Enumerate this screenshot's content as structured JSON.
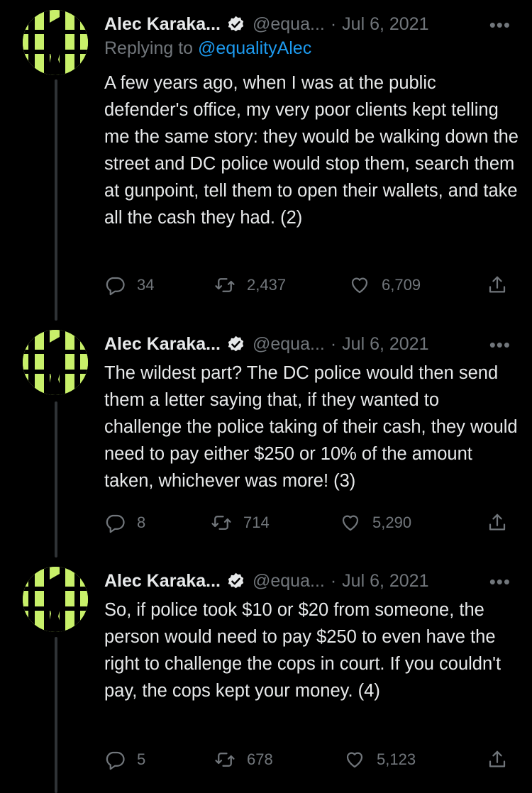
{
  "tweets": [
    {
      "author_name": "Alec Karaka...",
      "handle": "@equa...",
      "separator": "·",
      "date": "Jul 6, 2021",
      "more": "•••",
      "reply_prefix": "Replying to",
      "reply_handle": "@equalityAlec",
      "text": "A few years ago, when I was at the public defender's office, my very poor clients kept telling me the same story: they would be walking down the street and DC police would stop them, search them at gunpoint, tell them to open their wallets, and take all the cash they had. (2)",
      "replies": "34",
      "retweets": "2,437",
      "likes": "6,709"
    },
    {
      "author_name": "Alec Karaka...",
      "handle": "@equa...",
      "separator": "·",
      "date": "Jul 6, 2021",
      "more": "•••",
      "text": "The wildest part? The DC police would then send them a letter saying that, if they wanted to challenge the police taking of their cash, they would need to pay either $250 or 10% of the amount taken, whichever was more! (3)",
      "replies": "8",
      "retweets": "714",
      "likes": "5,290"
    },
    {
      "author_name": "Alec Karaka...",
      "handle": "@equa...",
      "separator": "·",
      "date": "Jul 6, 2021",
      "more": "•••",
      "text": "So, if police took $10 or $20 from someone, the person would need to pay $250 to even have the right to challenge the cops in court. If you couldn't pay, the cops kept your money.  (4)",
      "replies": "5",
      "retweets": "678",
      "likes": "5,123"
    }
  ],
  "colors": {
    "background": "#000000",
    "text": "#e7e9ea",
    "muted": "#71767b",
    "link": "#1d9bf0",
    "avatar": "#c8f06a",
    "thread_line": "#2f3336"
  }
}
